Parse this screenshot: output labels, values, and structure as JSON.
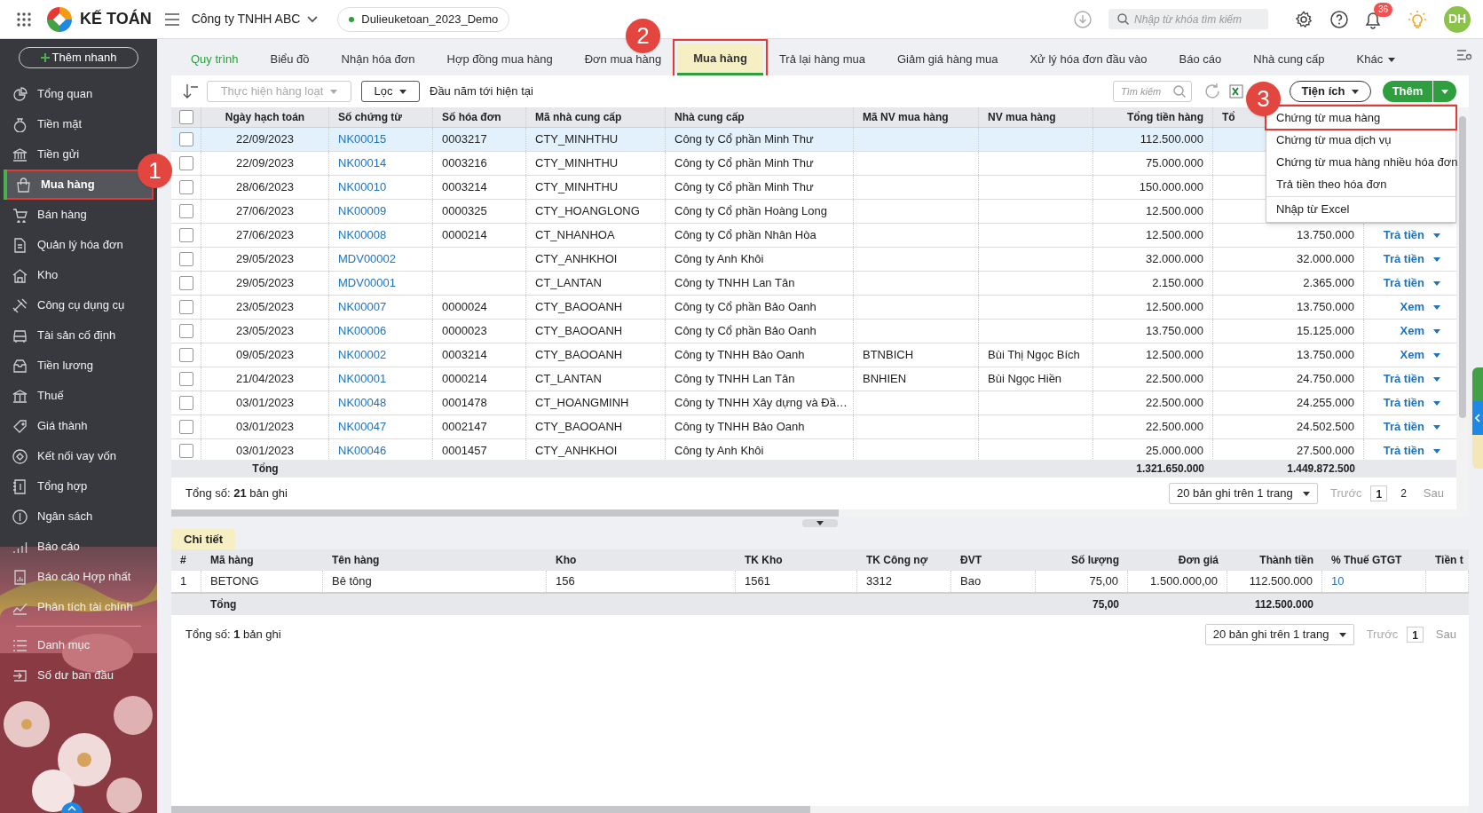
{
  "header": {
    "app_name": "KẾ TOÁN",
    "company": "Công ty TNHH ABC",
    "database": "Dulieuketoan_2023_Demo",
    "search_placeholder": "Nhập từ khóa tìm kiếm",
    "notification_count": "36",
    "avatar": "DH"
  },
  "sidebar": {
    "quick_add": "Thêm nhanh",
    "items": [
      {
        "label": "Tổng quan",
        "selected": false,
        "highlighted": false
      },
      {
        "label": "Tiền mặt",
        "selected": false,
        "highlighted": false
      },
      {
        "label": "Tiền gửi",
        "selected": false,
        "highlighted": false
      },
      {
        "label": "Mua hàng",
        "selected": true,
        "highlighted": true
      },
      {
        "label": "Bán hàng",
        "selected": false,
        "highlighted": false
      },
      {
        "label": "Quản lý hóa đơn",
        "selected": false,
        "highlighted": false
      },
      {
        "label": "Kho",
        "selected": false,
        "highlighted": false
      },
      {
        "label": "Công cụ dụng cụ",
        "selected": false,
        "highlighted": false
      },
      {
        "label": "Tài sản cố định",
        "selected": false,
        "highlighted": false
      },
      {
        "label": "Tiền lương",
        "selected": false,
        "highlighted": false
      },
      {
        "label": "Thuế",
        "selected": false,
        "highlighted": false
      },
      {
        "label": "Giá thành",
        "selected": false,
        "highlighted": false
      },
      {
        "label": "Kết nối vay vốn",
        "selected": false,
        "highlighted": false
      },
      {
        "label": "Tổng hợp",
        "selected": false,
        "highlighted": false
      },
      {
        "label": "Ngân sách",
        "selected": false,
        "highlighted": false
      },
      {
        "label": "Báo cáo",
        "selected": false,
        "highlighted": false
      },
      {
        "label": "Báo cáo Hợp nhất",
        "selected": false,
        "highlighted": false
      },
      {
        "label": "Phân tích tài chính",
        "selected": false,
        "highlighted": false
      }
    ],
    "footer_items": [
      {
        "label": "Danh mục",
        "selected": false
      },
      {
        "label": "Số dư ban đầu",
        "selected": false
      }
    ]
  },
  "tabs": [
    {
      "label": "Quy trình",
      "kind": "link",
      "selected": false,
      "highlighted": false
    },
    {
      "label": "Biểu đồ",
      "kind": "tab",
      "selected": false,
      "highlighted": false
    },
    {
      "label": "Nhận hóa đơn",
      "kind": "tab",
      "selected": false,
      "highlighted": false
    },
    {
      "label": "Hợp đồng mua hàng",
      "kind": "tab",
      "selected": false,
      "highlighted": false
    },
    {
      "label": "Đơn mua hàng",
      "kind": "tab",
      "selected": false,
      "highlighted": false
    },
    {
      "label": "Mua hàng",
      "kind": "tab",
      "selected": true,
      "highlighted": true
    },
    {
      "label": "Trả lại hàng mua",
      "kind": "tab",
      "selected": false,
      "highlighted": false
    },
    {
      "label": "Giảm giá hàng mua",
      "kind": "tab",
      "selected": false,
      "highlighted": false
    },
    {
      "label": "Xử lý hóa đơn đầu vào",
      "kind": "tab",
      "selected": false,
      "highlighted": false
    },
    {
      "label": "Báo cáo",
      "kind": "tab",
      "selected": false,
      "highlighted": false
    },
    {
      "label": "Nhà cung cấp",
      "kind": "tab",
      "selected": false,
      "highlighted": false
    },
    {
      "label": "Khác",
      "kind": "menu",
      "selected": false,
      "highlighted": false
    }
  ],
  "toolbar": {
    "batch_action": "Thực hiện hàng loạt",
    "filter": "Lọc",
    "period": "Đầu năm tới hiện tại",
    "search_placeholder": "Tìm kiếm",
    "utilities": "Tiện ích",
    "add": "Thêm"
  },
  "add_menu": {
    "items": [
      {
        "label": "Chứng từ mua hàng",
        "highlighted": true
      },
      {
        "label": "Chứng từ mua dịch vụ",
        "highlighted": false
      },
      {
        "label": "Chứng từ mua hàng nhiều hóa đơn",
        "highlighted": false
      },
      {
        "label": "Trả tiền theo hóa đơn",
        "highlighted": false
      },
      {
        "label": "Nhập từ Excel",
        "highlighted": false
      }
    ]
  },
  "callouts": [
    {
      "label": "1"
    },
    {
      "label": "2"
    },
    {
      "label": "3"
    }
  ],
  "table": {
    "columns": [
      "Ngày hạch toán",
      "Số chứng từ",
      "Số hóa đơn",
      "Mã nhà cung cấp",
      "Nhà cung cấp",
      "Mã NV mua hàng",
      "NV mua hàng",
      "Tổng tiền hàng",
      "Tổ"
    ],
    "all_checked": false,
    "rows": [
      {
        "selected": true,
        "checked": false,
        "date": "22/09/2023",
        "voucher": "NK00015",
        "invoice": "0003217",
        "supplier_code": "CTY_MINHTHU",
        "supplier": "Công ty Cổ phần Minh Thư",
        "goods_total": "112.500.000"
      },
      {
        "selected": false,
        "checked": false,
        "date": "22/09/2023",
        "voucher": "NK00014",
        "invoice": "0003216",
        "supplier_code": "CTY_MINHTHU",
        "supplier": "Công ty Cổ phần Minh Thư",
        "goods_total": "75.000.000"
      },
      {
        "selected": false,
        "checked": false,
        "date": "28/06/2023",
        "voucher": "NK00010",
        "invoice": "0003214",
        "supplier_code": "CTY_MINHTHU",
        "supplier": "Công ty Cổ phần Minh Thư",
        "goods_total": "150.000.000"
      },
      {
        "selected": false,
        "checked": false,
        "date": "27/06/2023",
        "voucher": "NK00009",
        "invoice": "0000325",
        "supplier_code": "CTY_HOANGLONG",
        "supplier": "Công ty Cổ phần Hoàng Long",
        "goods_total": "12.500.000"
      },
      {
        "selected": false,
        "checked": false,
        "date": "27/06/2023",
        "voucher": "NK00008",
        "invoice": "0000214",
        "supplier_code": "CT_NHANHOA",
        "supplier": "Công ty Cổ phần Nhân Hòa",
        "goods_total": "12.500.000",
        "grand_total": "13.750.000",
        "action": "Trả tiền"
      },
      {
        "selected": false,
        "checked": false,
        "date": "29/05/2023",
        "voucher": "MDV00002",
        "supplier_code": "CTY_ANHKHOI",
        "supplier": "Công ty Anh Khôi",
        "goods_total": "32.000.000",
        "grand_total": "32.000.000",
        "action": "Trả tiền"
      },
      {
        "selected": false,
        "checked": false,
        "date": "29/05/2023",
        "voucher": "MDV00001",
        "supplier_code": "CT_LANTAN",
        "supplier": "Công ty TNHH Lan Tân",
        "goods_total": "2.150.000",
        "grand_total": "2.365.000",
        "action": "Trả tiền"
      },
      {
        "selected": false,
        "checked": false,
        "date": "23/05/2023",
        "voucher": "NK00007",
        "invoice": "0000024",
        "supplier_code": "CTY_BAOOANH",
        "supplier": "Công ty Cổ phần Bảo Oanh",
        "goods_total": "12.500.000",
        "grand_total": "13.750.000",
        "action": "Xem"
      },
      {
        "selected": false,
        "checked": false,
        "date": "23/05/2023",
        "voucher": "NK00006",
        "invoice": "0000023",
        "supplier_code": "CTY_BAOOANH",
        "supplier": "Công ty Cổ phần Bảo Oanh",
        "goods_total": "13.750.000",
        "grand_total": "15.125.000",
        "action": "Xem"
      },
      {
        "selected": false,
        "checked": false,
        "date": "09/05/2023",
        "voucher": "NK00002",
        "invoice": "0003214",
        "supplier_code": "CTY_BAOOANH",
        "supplier": "Công ty TNHH Bảo Oanh",
        "staff_code": "BTNBICH",
        "staff": "Bùi Thị Ngọc Bích",
        "goods_total": "12.500.000",
        "grand_total": "13.750.000",
        "action": "Xem"
      },
      {
        "selected": false,
        "checked": false,
        "date": "21/04/2023",
        "voucher": "NK00001",
        "invoice": "0000214",
        "supplier_code": "CT_LANTAN",
        "supplier": "Công ty TNHH Lan Tân",
        "staff_code": "BNHIEN",
        "staff": "Bùi Ngọc Hiền",
        "goods_total": "22.500.000",
        "grand_total": "24.750.000",
        "action": "Trả tiền"
      },
      {
        "selected": false,
        "checked": false,
        "date": "03/01/2023",
        "voucher": "NK00048",
        "invoice": "0001478",
        "supplier_code": "CT_HOANGMINH",
        "supplier": "Công ty TNHH Xây dựng và Đầ…",
        "goods_total": "22.500.000",
        "grand_total": "24.255.000",
        "action": "Trả tiền"
      },
      {
        "selected": false,
        "checked": false,
        "date": "03/01/2023",
        "voucher": "NK00047",
        "invoice": "0002147",
        "supplier_code": "CTY_BAOOANH",
        "supplier": "Công ty TNHH Bảo Oanh",
        "goods_total": "22.500.000",
        "grand_total": "24.502.500",
        "action": "Trả tiền"
      },
      {
        "selected": false,
        "checked": false,
        "date": "03/01/2023",
        "voucher": "NK00046",
        "invoice": "0001457",
        "supplier_code": "CTY_ANHKHOI",
        "supplier": "Công ty Anh Khôi",
        "goods_total": "25.000.000",
        "grand_total": "27.500.000",
        "action": "Trả tiền"
      }
    ],
    "total": {
      "label": "Tổng",
      "goods_total": "1.321.650.000",
      "grand_total": "1.449.872.500"
    },
    "pager": {
      "count": "Tổng số: **21** bản ghi",
      "page_size": "20 bản ghi trên 1 trang",
      "prev": "Trước",
      "pages": [
        {
          "label": "1",
          "selected": true
        },
        {
          "label": "2",
          "selected": false
        }
      ],
      "next": "Sau"
    }
  },
  "detail": {
    "tab": "Chi tiết",
    "columns": [
      "#",
      "Mã hàng",
      "Tên hàng",
      "Kho",
      "TK Kho",
      "TK Công nợ",
      "ĐVT",
      "Số lượng",
      "Đơn giá",
      "Thành tiền",
      "% Thuế GTGT",
      "Tiền t"
    ],
    "rows": [
      [
        "1",
        "BETONG",
        "Bê tông",
        "156",
        "1561",
        "3312",
        "Bao",
        "75,00",
        "1.500.000,00",
        "112.500.000",
        "10"
      ]
    ],
    "total": {
      "label": "Tổng",
      "quantity": "75,00",
      "amount": "112.500.000"
    },
    "pager": {
      "count": "Tổng số: **1** bản ghi",
      "page_size": "20 bản ghi trên 1 trang",
      "prev": "Trước",
      "pages": [
        {
          "label": "1",
          "selected": true
        }
      ],
      "next": "Sau"
    }
  }
}
